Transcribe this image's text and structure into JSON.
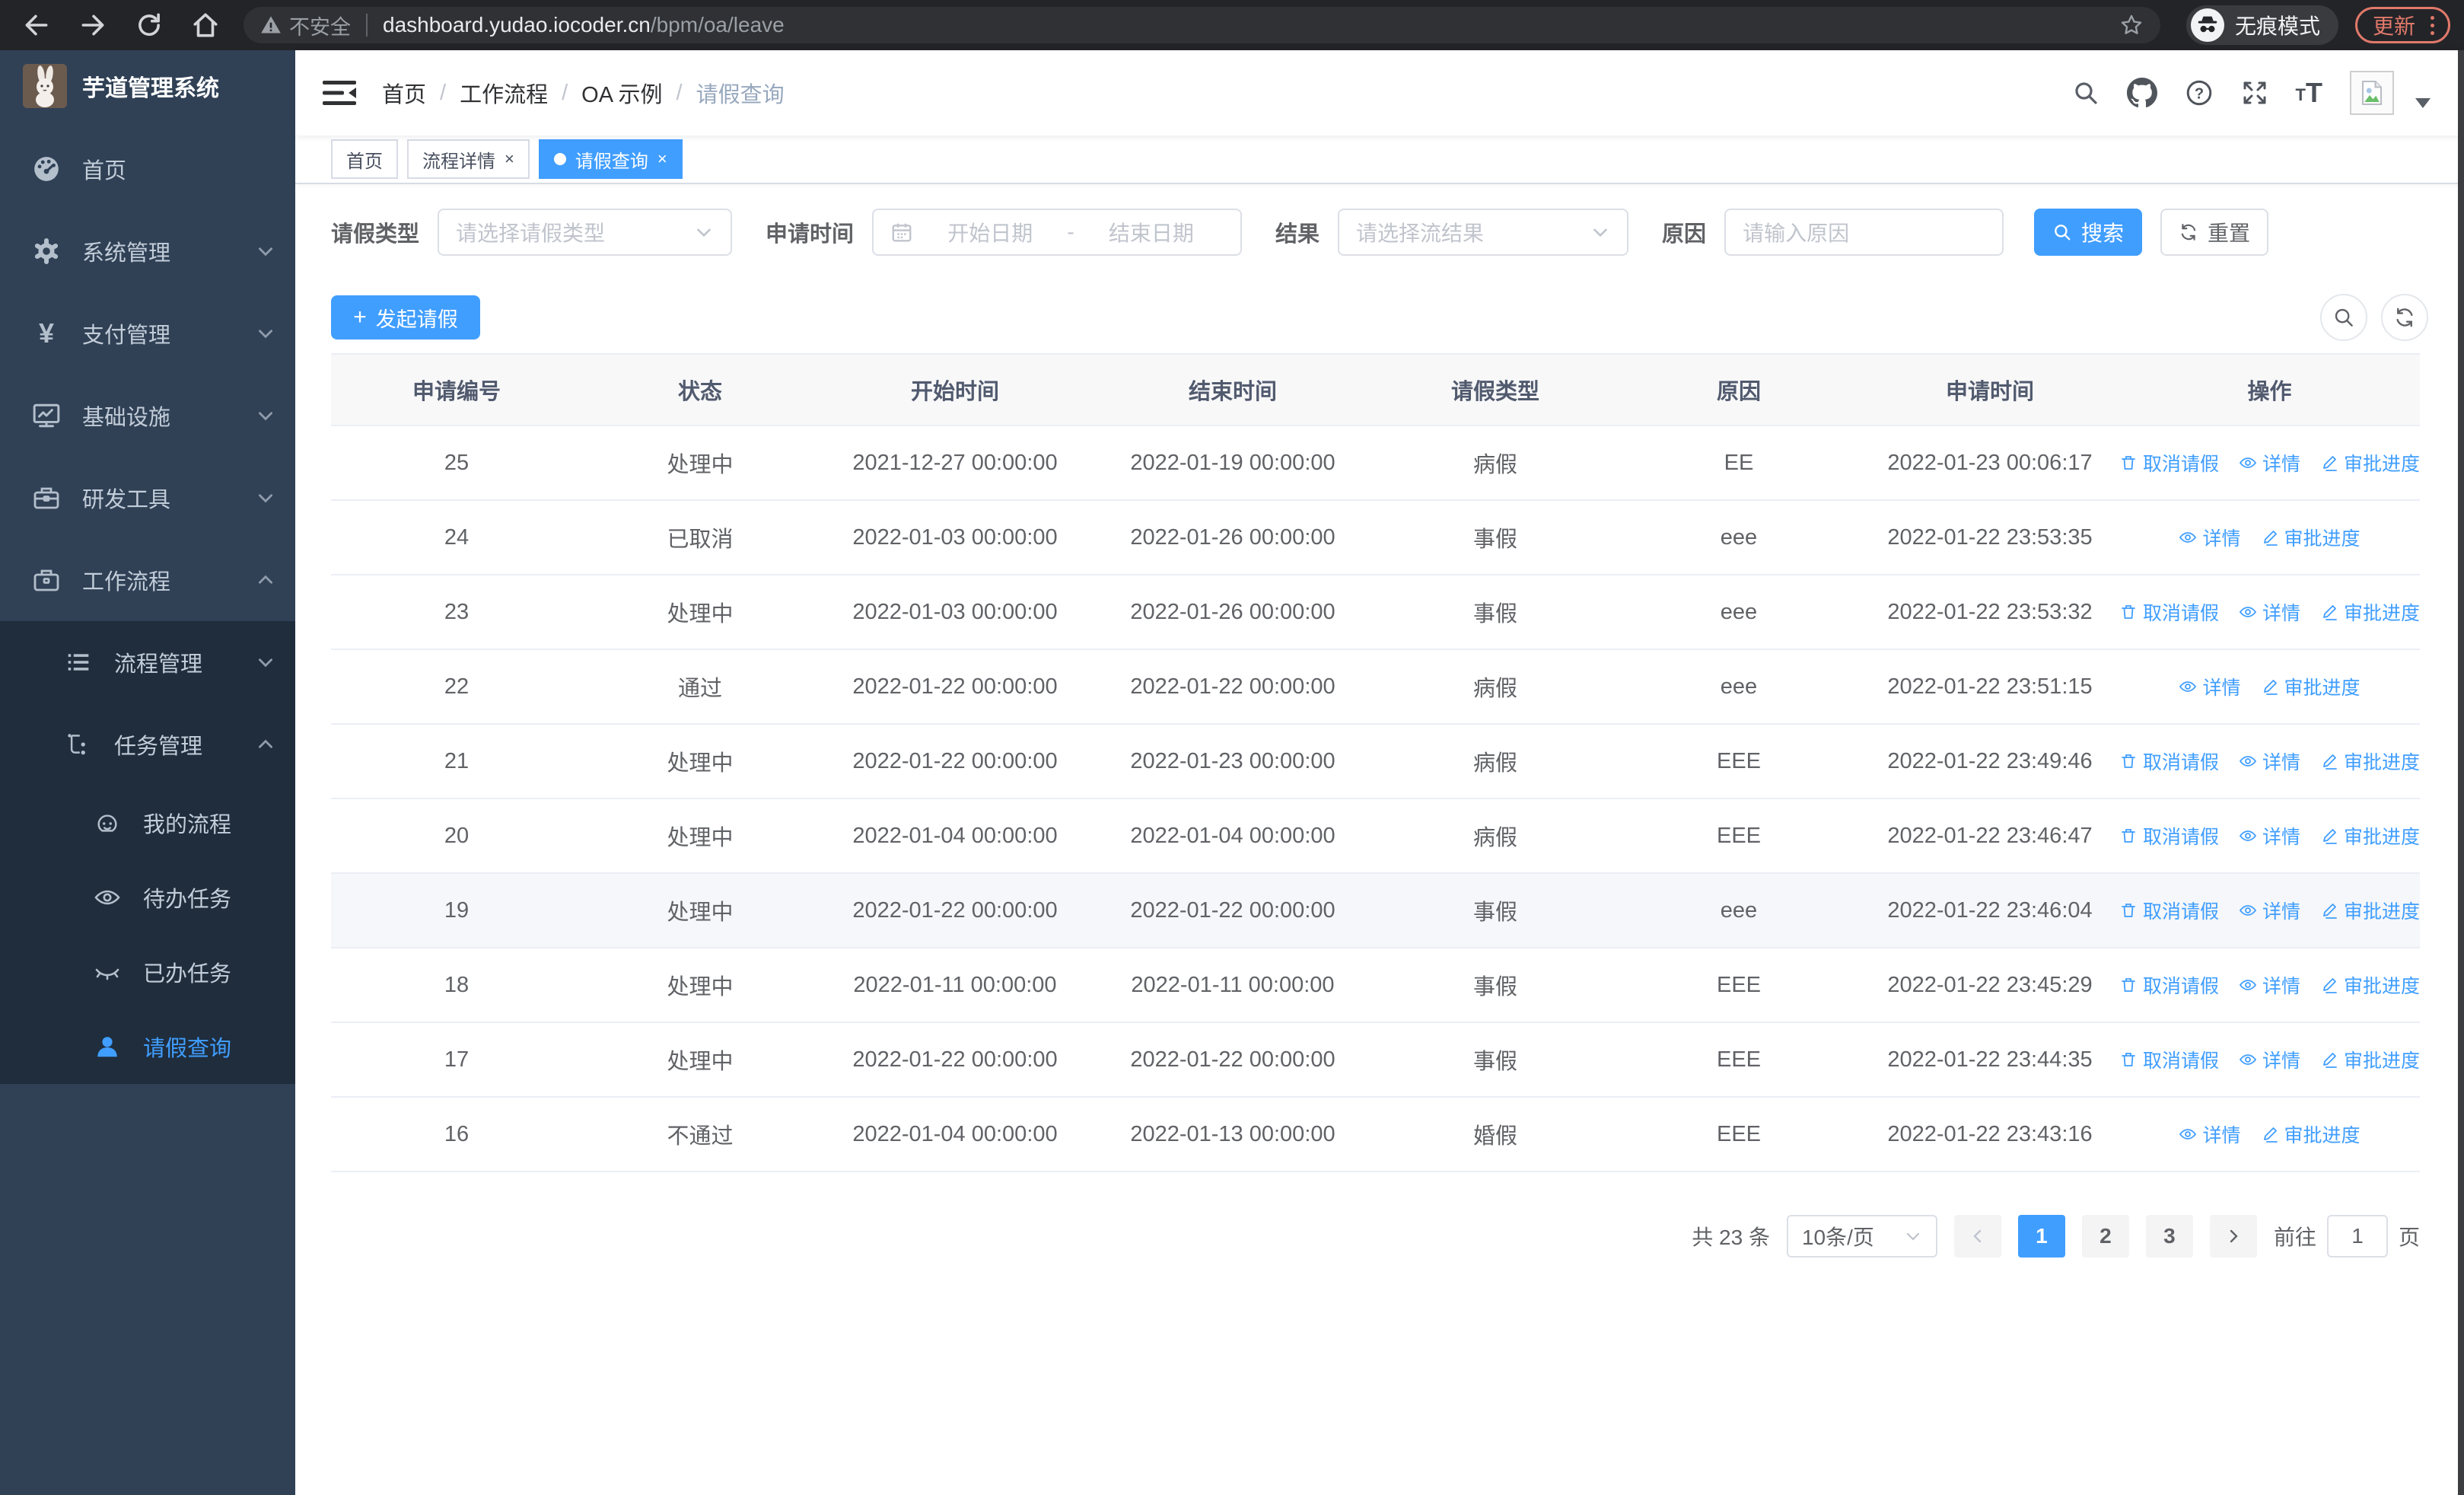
{
  "browser": {
    "security_warning": "不安全",
    "url_host": "dashboard.yudao.iocoder.cn",
    "url_path": "/bpm/oa/leave",
    "incognito_label": "无痕模式",
    "update_label": "更新"
  },
  "colors": {
    "accent": "#409eff",
    "sidebar_bg": "#304156",
    "submenu_bg": "#1f2d3d",
    "update_pill": "#e0796a"
  },
  "sidebar": {
    "app_title": "芋道管理系统",
    "menu": [
      {
        "label": "首页",
        "icon": "dashboard-icon"
      },
      {
        "label": "系统管理",
        "icon": "gear-icon",
        "chevron": "down"
      },
      {
        "label": "支付管理",
        "icon": "yen-icon",
        "chevron": "down"
      },
      {
        "label": "基础设施",
        "icon": "monitor-icon",
        "chevron": "down"
      },
      {
        "label": "研发工具",
        "icon": "toolbox-icon",
        "chevron": "down"
      },
      {
        "label": "工作流程",
        "icon": "briefcase-icon",
        "chevron": "up"
      }
    ],
    "submenu": [
      {
        "label": "流程管理",
        "icon": "list-icon",
        "chevron": "down"
      },
      {
        "label": "任务管理",
        "icon": "tree-icon",
        "chevron": "up"
      }
    ],
    "task_children": [
      {
        "label": "我的流程",
        "icon": "robot-icon"
      },
      {
        "label": "待办任务",
        "icon": "eye-icon"
      },
      {
        "label": "已办任务",
        "icon": "eye-closed-icon"
      },
      {
        "label": "请假查询",
        "icon": "user-icon",
        "active": true
      }
    ]
  },
  "breadcrumb": {
    "items": [
      "首页",
      "工作流程",
      "OA 示例",
      "请假查询"
    ]
  },
  "tabs": [
    {
      "label": "首页"
    },
    {
      "label": "流程详情",
      "closable": true
    },
    {
      "label": "请假查询",
      "closable": true,
      "active": true
    }
  ],
  "filters": {
    "leave_type_label": "请假类型",
    "leave_type_placeholder": "请选择请假类型",
    "apply_time_label": "申请时间",
    "date_start_placeholder": "开始日期",
    "date_separator": "-",
    "date_end_placeholder": "结束日期",
    "result_label": "结果",
    "result_placeholder": "请选择流结果",
    "reason_label": "原因",
    "reason_placeholder": "请输入原因",
    "search_label": "搜索",
    "reset_label": "重置"
  },
  "toolbar": {
    "create_label": "发起请假"
  },
  "table": {
    "headers": [
      "申请编号",
      "状态",
      "开始时间",
      "结束时间",
      "请假类型",
      "原因",
      "申请时间",
      "操作"
    ],
    "action_labels": {
      "cancel": "取消请假",
      "detail": "详情",
      "progress": "审批进度"
    },
    "rows": [
      {
        "id": "25",
        "status": "处理中",
        "start": "2021-12-27 00:00:00",
        "end": "2022-01-19 00:00:00",
        "type": "病假",
        "reason": "EE",
        "apply_time": "2022-01-23 00:06:17",
        "can_cancel": true,
        "highlight": false
      },
      {
        "id": "24",
        "status": "已取消",
        "start": "2022-01-03 00:00:00",
        "end": "2022-01-26 00:00:00",
        "type": "事假",
        "reason": "eee",
        "apply_time": "2022-01-22 23:53:35",
        "can_cancel": false,
        "highlight": false
      },
      {
        "id": "23",
        "status": "处理中",
        "start": "2022-01-03 00:00:00",
        "end": "2022-01-26 00:00:00",
        "type": "事假",
        "reason": "eee",
        "apply_time": "2022-01-22 23:53:32",
        "can_cancel": true,
        "highlight": false
      },
      {
        "id": "22",
        "status": "通过",
        "start": "2022-01-22 00:00:00",
        "end": "2022-01-22 00:00:00",
        "type": "病假",
        "reason": "eee",
        "apply_time": "2022-01-22 23:51:15",
        "can_cancel": false,
        "highlight": false
      },
      {
        "id": "21",
        "status": "处理中",
        "start": "2022-01-22 00:00:00",
        "end": "2022-01-23 00:00:00",
        "type": "病假",
        "reason": "EEE",
        "apply_time": "2022-01-22 23:49:46",
        "can_cancel": true,
        "highlight": false
      },
      {
        "id": "20",
        "status": "处理中",
        "start": "2022-01-04 00:00:00",
        "end": "2022-01-04 00:00:00",
        "type": "病假",
        "reason": "EEE",
        "apply_time": "2022-01-22 23:46:47",
        "can_cancel": true,
        "highlight": false
      },
      {
        "id": "19",
        "status": "处理中",
        "start": "2022-01-22 00:00:00",
        "end": "2022-01-22 00:00:00",
        "type": "事假",
        "reason": "eee",
        "apply_time": "2022-01-22 23:46:04",
        "can_cancel": true,
        "highlight": true
      },
      {
        "id": "18",
        "status": "处理中",
        "start": "2022-01-11 00:00:00",
        "end": "2022-01-11 00:00:00",
        "type": "事假",
        "reason": "EEE",
        "apply_time": "2022-01-22 23:45:29",
        "can_cancel": true,
        "highlight": false
      },
      {
        "id": "17",
        "status": "处理中",
        "start": "2022-01-22 00:00:00",
        "end": "2022-01-22 00:00:00",
        "type": "事假",
        "reason": "EEE",
        "apply_time": "2022-01-22 23:44:35",
        "can_cancel": true,
        "highlight": false
      },
      {
        "id": "16",
        "status": "不通过",
        "start": "2022-01-04 00:00:00",
        "end": "2022-01-13 00:00:00",
        "type": "婚假",
        "reason": "EEE",
        "apply_time": "2022-01-22 23:43:16",
        "can_cancel": false,
        "highlight": false
      }
    ]
  },
  "pagination": {
    "total": "共 23 条",
    "page_size": "10条/页",
    "pages": [
      "1",
      "2",
      "3"
    ],
    "active_page": "1",
    "goto_label": "前往",
    "goto_value": "1",
    "page_label": "页"
  }
}
